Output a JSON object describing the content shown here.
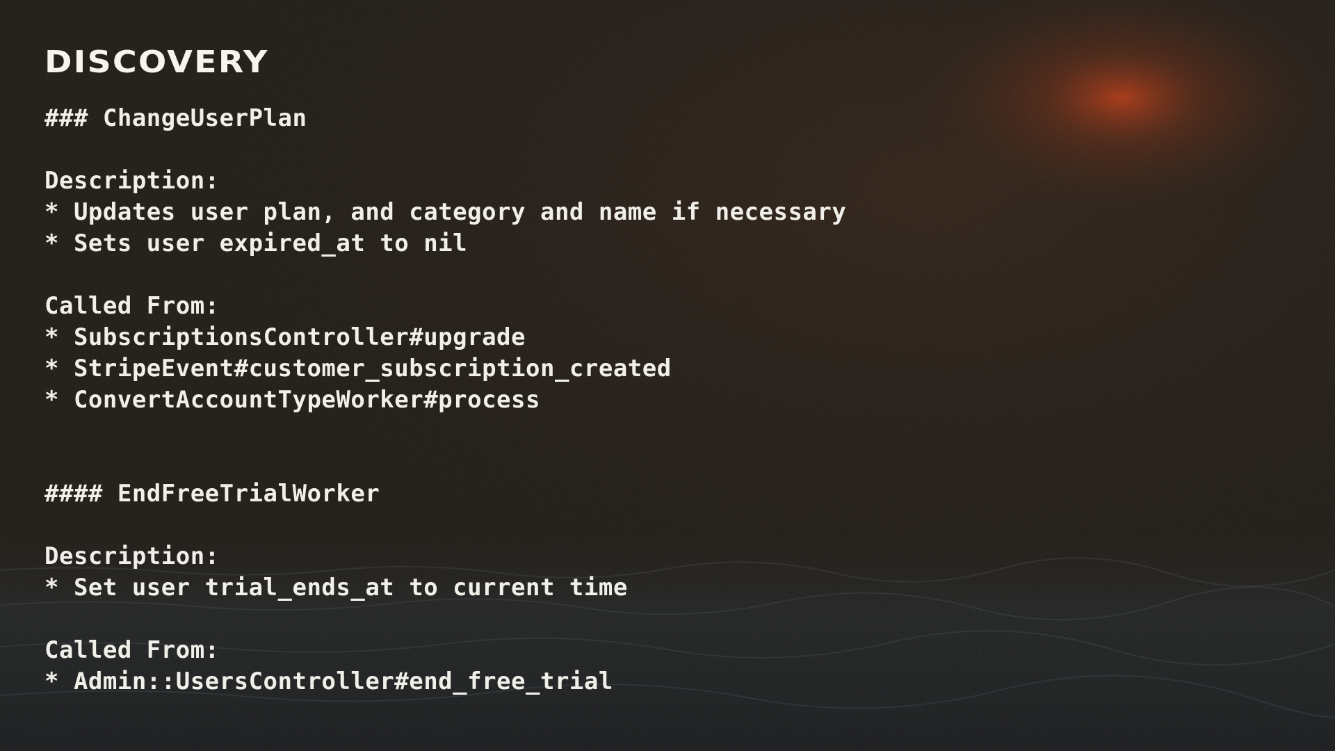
{
  "slide": {
    "title": "DISCOVERY",
    "sections": [
      {
        "heading": "### ChangeUserPlan",
        "description_label": "Description:",
        "description_items": [
          "* Updates user plan, and category and name if necessary",
          "* Sets user expired_at to nil"
        ],
        "called_from_label": "Called From:",
        "called_from_items": [
          "* SubscriptionsController#upgrade",
          "* StripeEvent#customer_subscription_created",
          "* ConvertAccountTypeWorker#process"
        ]
      },
      {
        "heading": "#### EndFreeTrialWorker",
        "description_label": "Description:",
        "description_items": [
          "* Set user trial_ends_at to current time"
        ],
        "called_from_label": "Called From:",
        "called_from_items": [
          "* Admin::UsersController#end_free_trial"
        ]
      }
    ]
  },
  "colors": {
    "background": "#161512",
    "text": "#f3f1ec",
    "glow": "#c23a12"
  }
}
